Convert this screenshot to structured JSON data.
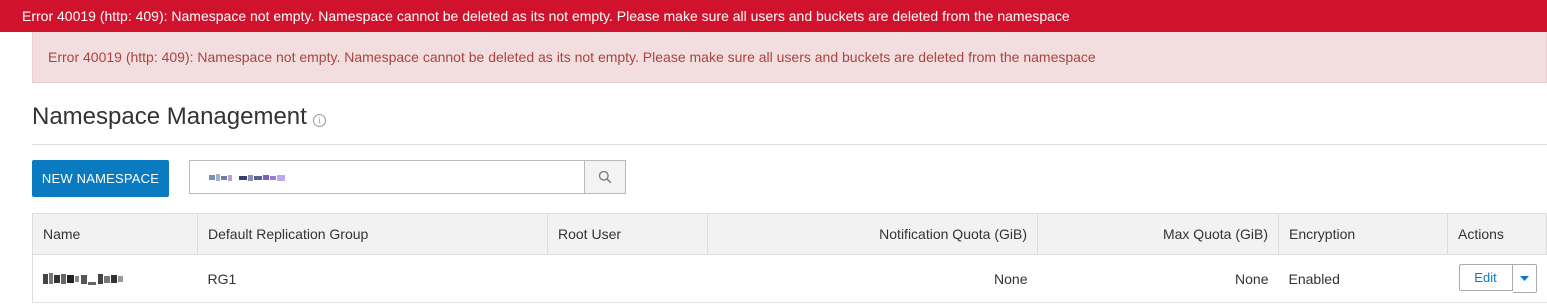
{
  "error_banner": {
    "text": "Error 40019 (http: 409): Namespace not empty. Namespace cannot be deleted as its not empty. Please make sure all users and buckets are deleted from the namespace"
  },
  "error_alert": {
    "text": "Error 40019 (http: 409): Namespace not empty. Namespace cannot be deleted as its not empty. Please make sure all users and buckets are deleted from the namespace"
  },
  "page": {
    "title": "Namespace Management",
    "info_icon": "info-icon"
  },
  "toolbar": {
    "new_label": "NEW NAMESPACE",
    "search_value": "",
    "search_icon": "search-icon"
  },
  "table": {
    "columns": [
      "Name",
      "Default Replication Group",
      "Root User",
      "Notification Quota (GiB)",
      "Max Quota (GiB)",
      "Encryption",
      "Actions"
    ],
    "rows": [
      {
        "name": "",
        "replication_group": "RG1",
        "root_user": "",
        "notification_quota": "None",
        "max_quota": "None",
        "encryption": "Enabled",
        "edit_label": "Edit"
      }
    ]
  },
  "colors": {
    "error_banner": "#d0122c",
    "alert_bg": "#f2dede",
    "alert_text": "#a94442",
    "primary": "#0b7bc1"
  }
}
